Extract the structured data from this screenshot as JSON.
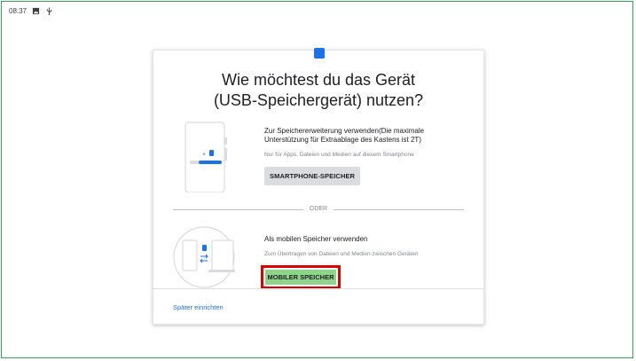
{
  "status_bar": {
    "time": "08:37",
    "icons": [
      "image-icon",
      "usb-icon"
    ]
  },
  "dialog": {
    "title_line1": "Wie möchtest du das Gerät",
    "title_line2": "(USB-Speichergerät) nutzen?",
    "option_internal": {
      "title": "Zur Speichererweiterung verwenden(Die maximale Unterstützung für Extraablage des Kastens ist 2T)",
      "subtitle": "Nur für Apps, Dateien und Medien auf diesem Smartphone",
      "button_label": "SMARTPHONE-SPEICHER"
    },
    "divider_label": "ODER",
    "option_portable": {
      "title": "Als mobilen Speicher verwenden",
      "subtitle": "Zum Übertragen von Dateien und Medien zwischen Geräten",
      "button_label": "MOBILER SPEICHER"
    },
    "later_link": "Später einrichten"
  },
  "colors": {
    "accent": "#1a73e8",
    "highlight": "#e00000",
    "portable_button": "#8fd48b",
    "frame": "#34a853"
  }
}
